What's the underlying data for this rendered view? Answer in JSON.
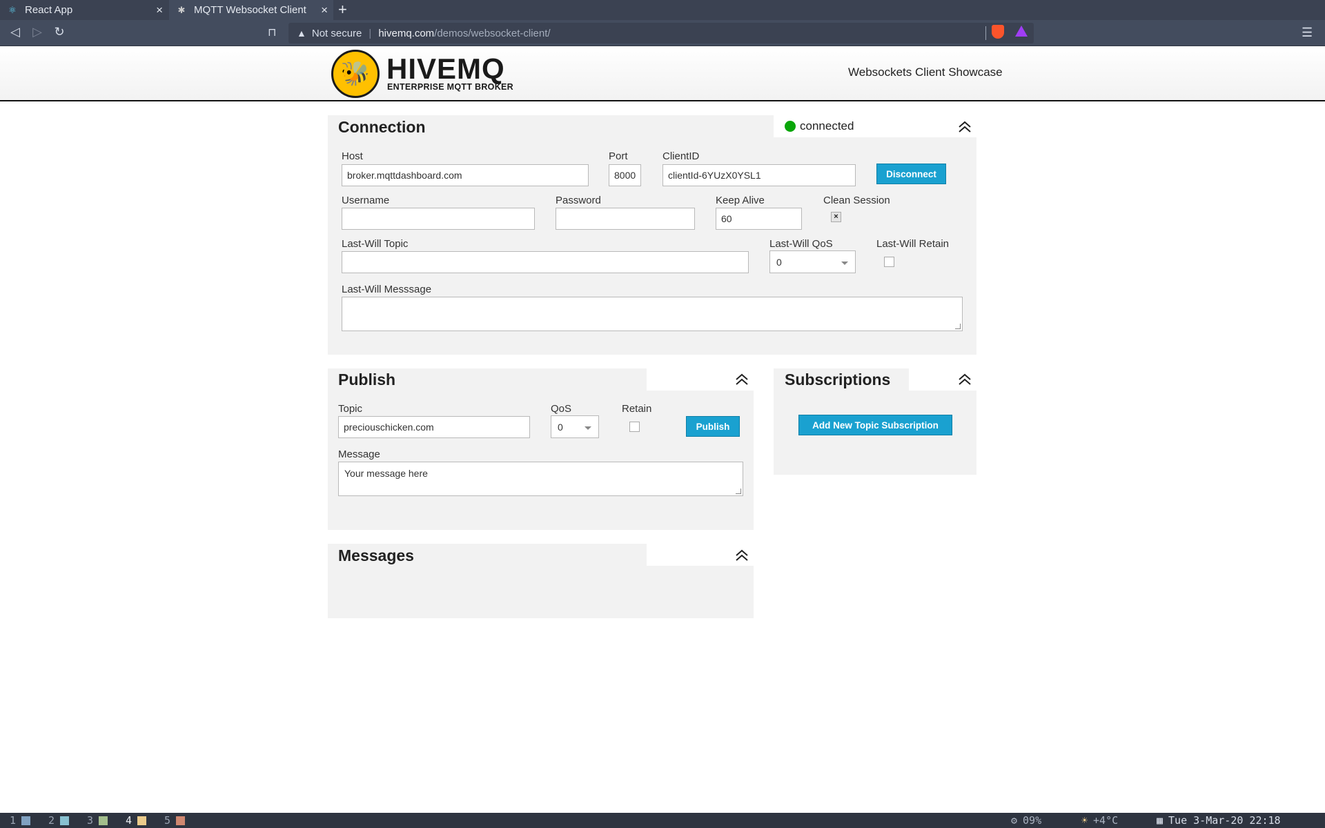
{
  "browser": {
    "tabs": [
      {
        "title": "React App",
        "icon": "react-icon"
      },
      {
        "title": "MQTT Websocket Client",
        "icon": "hivemq-favicon"
      }
    ],
    "security_label": "Not secure",
    "url_host": "hivemq.com",
    "url_path": "/demos/websocket-client/"
  },
  "header": {
    "logo_text": "HIVEMQ",
    "logo_subtitle": "ENTERPRISE MQTT BROKER",
    "showcase": "Websockets Client Showcase"
  },
  "connection": {
    "title": "Connection",
    "status": "connected",
    "status_color": "#0aa60a",
    "host_label": "Host",
    "host_value": "broker.mqttdashboard.com",
    "port_label": "Port",
    "port_value": "8000",
    "clientid_label": "ClientID",
    "clientid_value": "clientId-6YUzX0YSL1",
    "disconnect_label": "Disconnect",
    "username_label": "Username",
    "username_value": "",
    "password_label": "Password",
    "password_value": "",
    "keepalive_label": "Keep Alive",
    "keepalive_value": "60",
    "clean_session_label": "Clean Session",
    "clean_session_mark": "×",
    "lw_topic_label": "Last-Will Topic",
    "lw_topic_value": "",
    "lw_qos_label": "Last-Will QoS",
    "lw_qos_value": "0",
    "lw_retain_label": "Last-Will Retain",
    "lw_message_label": "Last-Will Messsage",
    "lw_message_value": ""
  },
  "publish": {
    "title": "Publish",
    "topic_label": "Topic",
    "topic_value": "preciouschicken.com",
    "qos_label": "QoS",
    "qos_value": "0",
    "retain_label": "Retain",
    "publish_label": "Publish",
    "message_label": "Message",
    "message_value": "Your message here"
  },
  "subscriptions": {
    "title": "Subscriptions",
    "add_label": "Add New Topic Subscription"
  },
  "messages": {
    "title": "Messages"
  },
  "taskbar": {
    "workspaces": [
      {
        "num": "1",
        "color": "#81a1c1"
      },
      {
        "num": "2",
        "color": "#88c0d0"
      },
      {
        "num": "3",
        "color": "#a3be8c"
      },
      {
        "num": "4",
        "color": "#ebcb8b"
      },
      {
        "num": "5",
        "color": "#d08770"
      }
    ],
    "cpu": "09%",
    "temp": "+4°C",
    "datetime": "Tue 3-Mar-20 22:18"
  }
}
